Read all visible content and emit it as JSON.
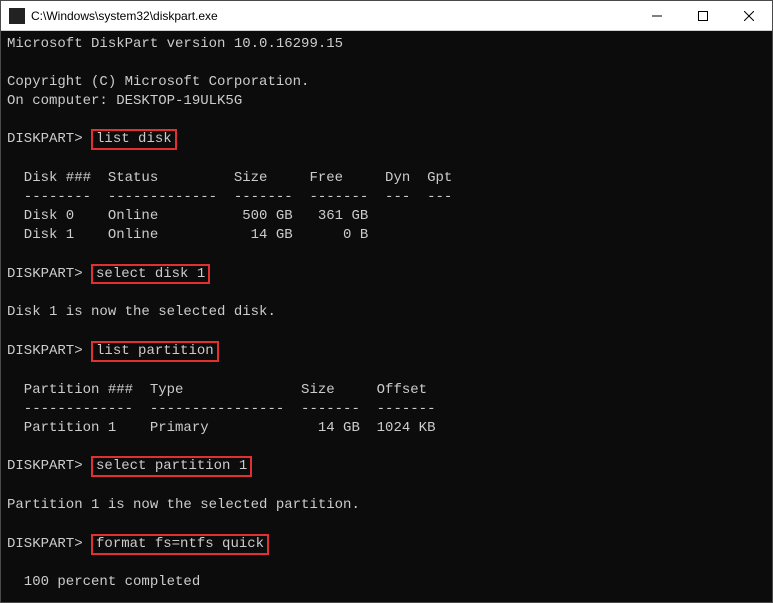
{
  "window": {
    "title": "C:\\Windows\\system32\\diskpart.exe"
  },
  "header": {
    "version_line": "Microsoft DiskPart version 10.0.16299.15",
    "copyright_line": "Copyright (C) Microsoft Corporation.",
    "computer_line": "On computer: DESKTOP-19ULK5G"
  },
  "prompt": "DISKPART>",
  "commands": {
    "list_disk": "list disk",
    "select_disk": "select disk 1",
    "list_partition": "list partition",
    "select_partition": "select partition 1",
    "format": "format fs=ntfs quick"
  },
  "disk_table": {
    "header": "  Disk ###  Status         Size     Free     Dyn  Gpt",
    "divider": "  --------  -------------  -------  -------  ---  ---",
    "rows": [
      "  Disk 0    Online          500 GB   361 GB",
      "  Disk 1    Online           14 GB      0 B"
    ]
  },
  "select_disk_msg": "Disk 1 is now the selected disk.",
  "partition_table": {
    "header": "  Partition ###  Type              Size     Offset",
    "divider": "  -------------  ----------------  -------  -------",
    "rows": [
      "  Partition 1    Primary             14 GB  1024 KB"
    ]
  },
  "select_partition_msg": "Partition 1 is now the selected partition.",
  "format_progress": "  100 percent completed"
}
